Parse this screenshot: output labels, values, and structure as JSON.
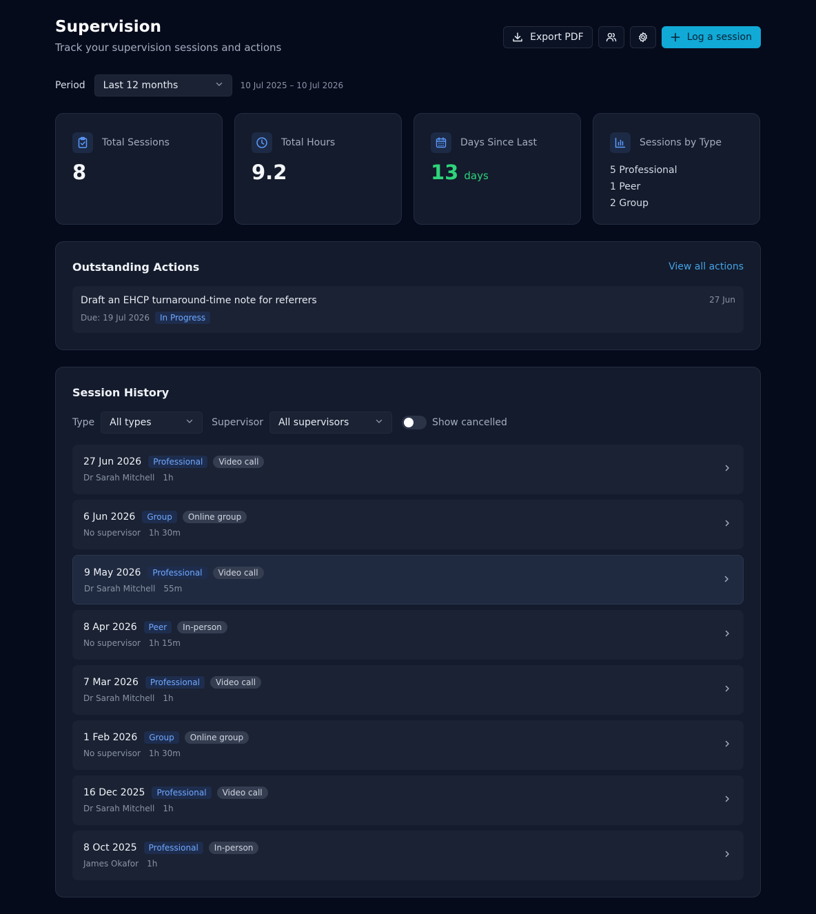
{
  "header": {
    "title": "Supervision",
    "subtitle": "Track your supervision sessions and actions",
    "export_label": "Export PDF",
    "log_label": "Log a session"
  },
  "period": {
    "label": "Period",
    "selected": "Last 12 months",
    "range": "10 Jul 2025 – 10 Jul 2026"
  },
  "stats": {
    "total_sessions": {
      "label": "Total Sessions",
      "value": "8"
    },
    "total_hours": {
      "label": "Total Hours",
      "value": "9.2"
    },
    "days_since": {
      "label": "Days Since Last",
      "value": "13",
      "unit": "days"
    },
    "by_type": {
      "label": "Sessions by Type",
      "items": [
        "5 Professional",
        "1 Peer",
        "2 Group"
      ]
    }
  },
  "actions": {
    "title": "Outstanding Actions",
    "view_all": "View all actions",
    "items": [
      {
        "title": "Draft an EHCP turnaround-time note for referrers",
        "due": "Due: 19 Jul 2026",
        "status": "In Progress",
        "date": "27 Jun"
      }
    ]
  },
  "history": {
    "title": "Session History",
    "type_label": "Type",
    "type_selected": "All types",
    "supervisor_label": "Supervisor",
    "supervisor_selected": "All supervisors",
    "show_cancelled": "Show cancelled",
    "sessions": [
      {
        "date": "27 Jun 2026",
        "type": "Professional",
        "mode": "Video call",
        "supervisor": "Dr Sarah Mitchell",
        "duration": "1h"
      },
      {
        "date": "6 Jun 2026",
        "type": "Group",
        "mode": "Online group",
        "supervisor": "No supervisor",
        "duration": "1h 30m"
      },
      {
        "date": "9 May 2026",
        "type": "Professional",
        "mode": "Video call",
        "supervisor": "Dr Sarah Mitchell",
        "duration": "55m"
      },
      {
        "date": "8 Apr 2026",
        "type": "Peer",
        "mode": "In-person",
        "supervisor": "No supervisor",
        "duration": "1h 15m"
      },
      {
        "date": "7 Mar 2026",
        "type": "Professional",
        "mode": "Video call",
        "supervisor": "Dr Sarah Mitchell",
        "duration": "1h"
      },
      {
        "date": "1 Feb 2026",
        "type": "Group",
        "mode": "Online group",
        "supervisor": "No supervisor",
        "duration": "1h 30m"
      },
      {
        "date": "16 Dec 2025",
        "type": "Professional",
        "mode": "Video call",
        "supervisor": "Dr Sarah Mitchell",
        "duration": "1h"
      },
      {
        "date": "8 Oct 2025",
        "type": "Professional",
        "mode": "In-person",
        "supervisor": "James Okafor",
        "duration": "1h"
      }
    ]
  },
  "colors": {
    "accent": "#11a9d6",
    "success": "#2fd37a",
    "link": "#45a3e6",
    "badge_blue": "#6fa8ff"
  }
}
